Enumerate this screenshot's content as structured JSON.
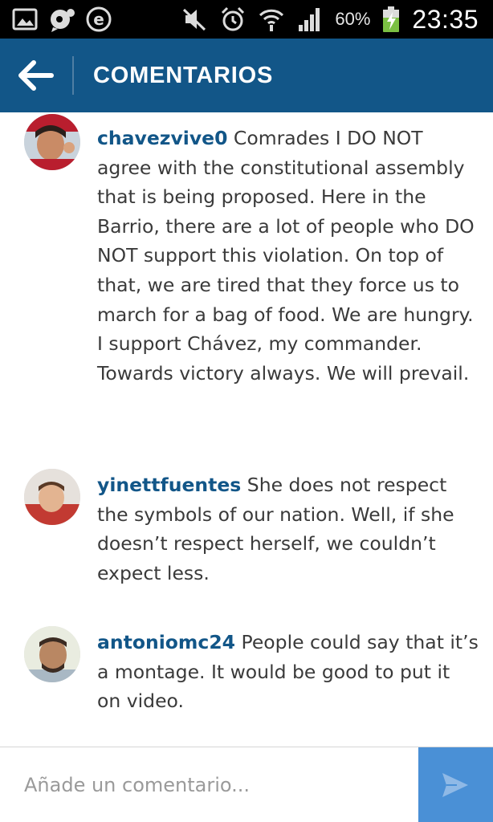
{
  "status_bar": {
    "battery": "60%",
    "time": "23:35",
    "left_icons": [
      "gallery-icon",
      "chat-notification-icon",
      "e-icon"
    ],
    "right_icons": [
      "mute-icon",
      "alarm-icon",
      "wifi-icon",
      "signal-icon",
      "battery-charging-icon"
    ]
  },
  "header": {
    "title": "COMENTARIOS",
    "back_icon": "back-arrow-icon",
    "background": "#125688"
  },
  "comments": [
    {
      "username": "chavezvive0",
      "text": "Comrades I DO NOT agree with the constitutional assembly that is being proposed. Here in the Barrio, there are a lot of people who DO NOT support this violation. On top of that, we are tired that they force us to march for a bag of food. We are hungry. I support Chávez, my commander. Towards victory always. We will prevail."
    },
    {
      "username": "yinettfuentes",
      "text": "She does not respect the symbols of our nation. Well, if she doesn’t respect herself, we couldn’t expect less."
    },
    {
      "username": "antoniomc24",
      "text": "People could say that it’s a montage. It would be good to put it on video."
    }
  ],
  "composer": {
    "placeholder": "Añade un comentario...",
    "value": "",
    "send_icon": "send-icon",
    "send_color": "#4a90d6"
  },
  "colors": {
    "username": "#125688",
    "text": "#3a3a3a"
  }
}
